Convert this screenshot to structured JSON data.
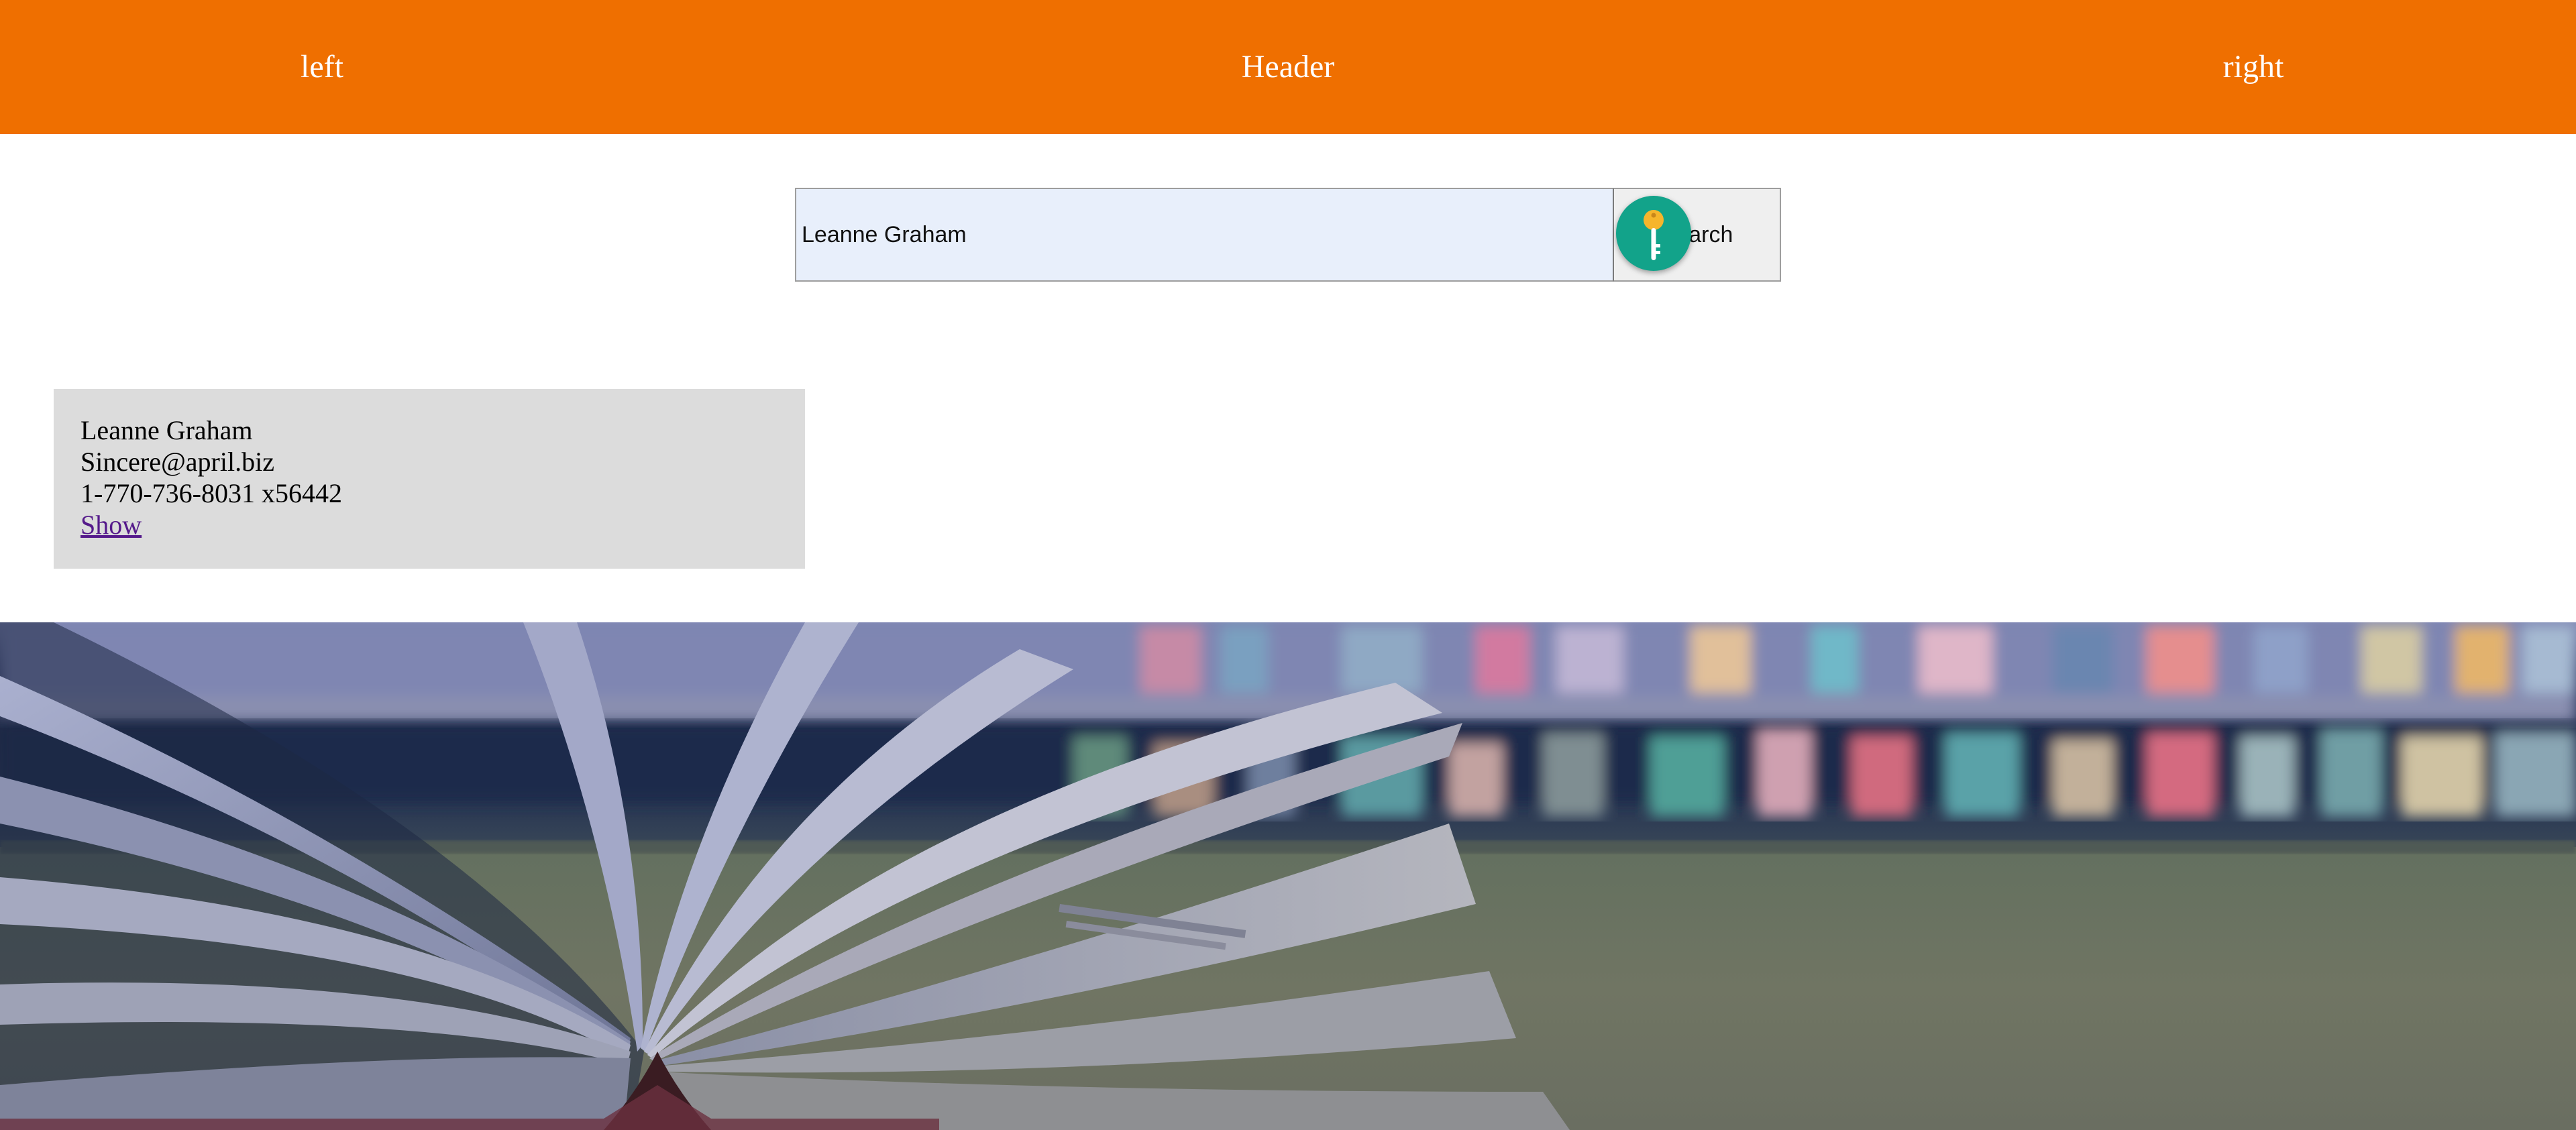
{
  "header": {
    "left": "left",
    "title": "Header",
    "right": "right",
    "background_color": "#ef6f00",
    "text_color": "#ffffff"
  },
  "search": {
    "value": "Leanne Graham",
    "button_label": "Search",
    "overlay_icon": "key-icon"
  },
  "user_card": {
    "name": "Leanne Graham",
    "email": "Sincere@april.biz",
    "phone": "1-770-736-8031 x56442",
    "link_label": "Show",
    "link_color": "#551a8b",
    "background_color": "#dcdcdc"
  },
  "hero": {
    "icon": "open-book-bookshelf-image"
  }
}
